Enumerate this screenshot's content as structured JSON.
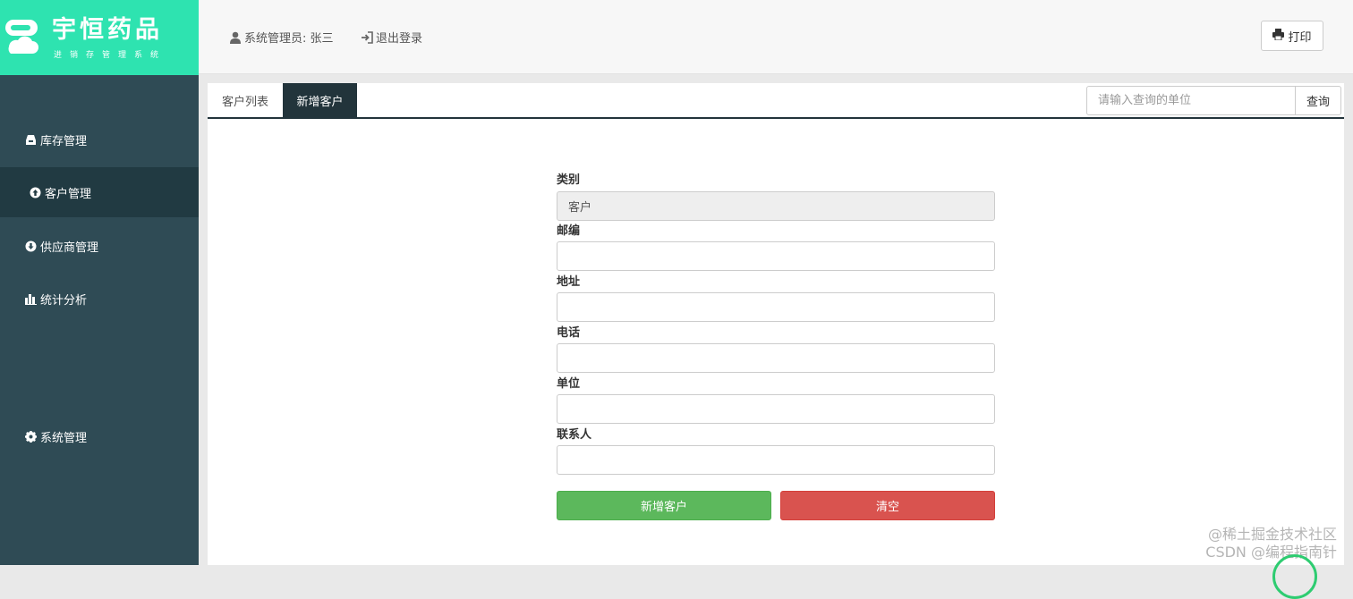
{
  "logo": {
    "title": "宇恒药品",
    "subtitle": "进销存管理系统"
  },
  "sidebar": {
    "items": [
      {
        "label": "库存管理",
        "icon": "inbox-icon"
      },
      {
        "label": "客户管理",
        "icon": "arrow-circle-up-icon"
      },
      {
        "label": "供应商管理",
        "icon": "arrow-circle-down-icon"
      },
      {
        "label": "统计分析",
        "icon": "bar-chart-icon"
      },
      {
        "label": "系统管理",
        "icon": "gear-icon"
      }
    ],
    "active_index": 1
  },
  "header": {
    "user_label": "系统管理员: 张三",
    "logout_label": "退出登录",
    "print_label": "打印"
  },
  "tabs": [
    {
      "label": "客户列表"
    },
    {
      "label": "新增客户"
    }
  ],
  "search": {
    "placeholder": "请输入查询的单位",
    "button_label": "查询"
  },
  "form": {
    "fields": [
      {
        "label": "类别",
        "value": "客户",
        "readonly": true
      },
      {
        "label": "邮编",
        "value": ""
      },
      {
        "label": "地址",
        "value": ""
      },
      {
        "label": "电话",
        "value": ""
      },
      {
        "label": "单位",
        "value": ""
      },
      {
        "label": "联系人",
        "value": ""
      }
    ],
    "submit_label": "新增客户",
    "clear_label": "清空"
  },
  "watermark": {
    "line1": "@稀土掘金技术社区",
    "line2": "CSDN @编程指南针"
  },
  "colors": {
    "sidebar_bg": "#2f4b55",
    "logo_bg": "#2ee3b0",
    "active_tab": "#22343b",
    "success": "#5cb85c",
    "danger": "#d9534f"
  }
}
